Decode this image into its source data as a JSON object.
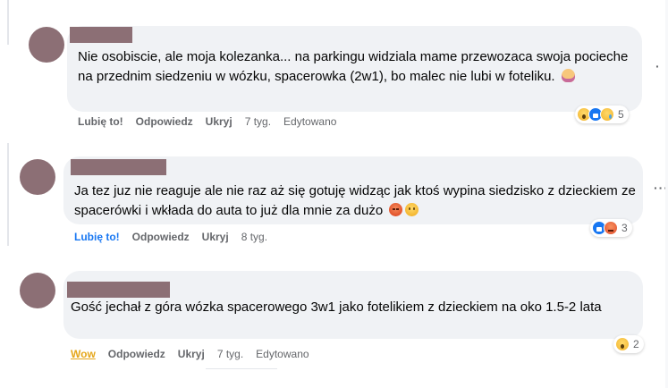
{
  "comments": [
    {
      "text": "Nie osobiscie, ale moja kolezanka... na parkingu widziala mame przewozaca swoja pocieche na przednim siedzeniu w wózku, spacerowka (2w1), bo malec nie lubi w foteliku.",
      "emoji_icons": [
        "woman-gesturing-emoji"
      ],
      "actions": {
        "like": "Lubię to!",
        "reply": "Odpowiedz",
        "hide": "Ukryj",
        "time": "7 tyg.",
        "edited": "Edytowano"
      },
      "reactions": {
        "icons": [
          "wow",
          "like",
          "sad"
        ],
        "count": "5"
      }
    },
    {
      "text": "Ja tez juz nie reaguje ale nie raz aż się gotuję widząc jak ktoś wypina siedzisko z dzieckiem ze spacerówki i wkłada do auta to już dla mnie za dużo",
      "emoji_icons": [
        "angry-emoji",
        "smile-emoji"
      ],
      "actions": {
        "like": "Lubię to!",
        "reply": "Odpowiedz",
        "hide": "Ukryj",
        "time": "8 tyg."
      },
      "reactions": {
        "icons": [
          "like",
          "angry"
        ],
        "count": "3"
      }
    },
    {
      "text": "Gość jechał z góra wózka spacerowego 3w1 jako fotelikiem z dzieckiem na oko 1.5-2 lata",
      "actions": {
        "like": "Wow",
        "reply": "Odpowiedz",
        "hide": "Ukryj",
        "time": "7 tyg.",
        "edited": "Edytowano"
      },
      "reactions": {
        "icons": [
          "wow"
        ],
        "count": "2"
      }
    }
  ],
  "more_menu_label": "···"
}
